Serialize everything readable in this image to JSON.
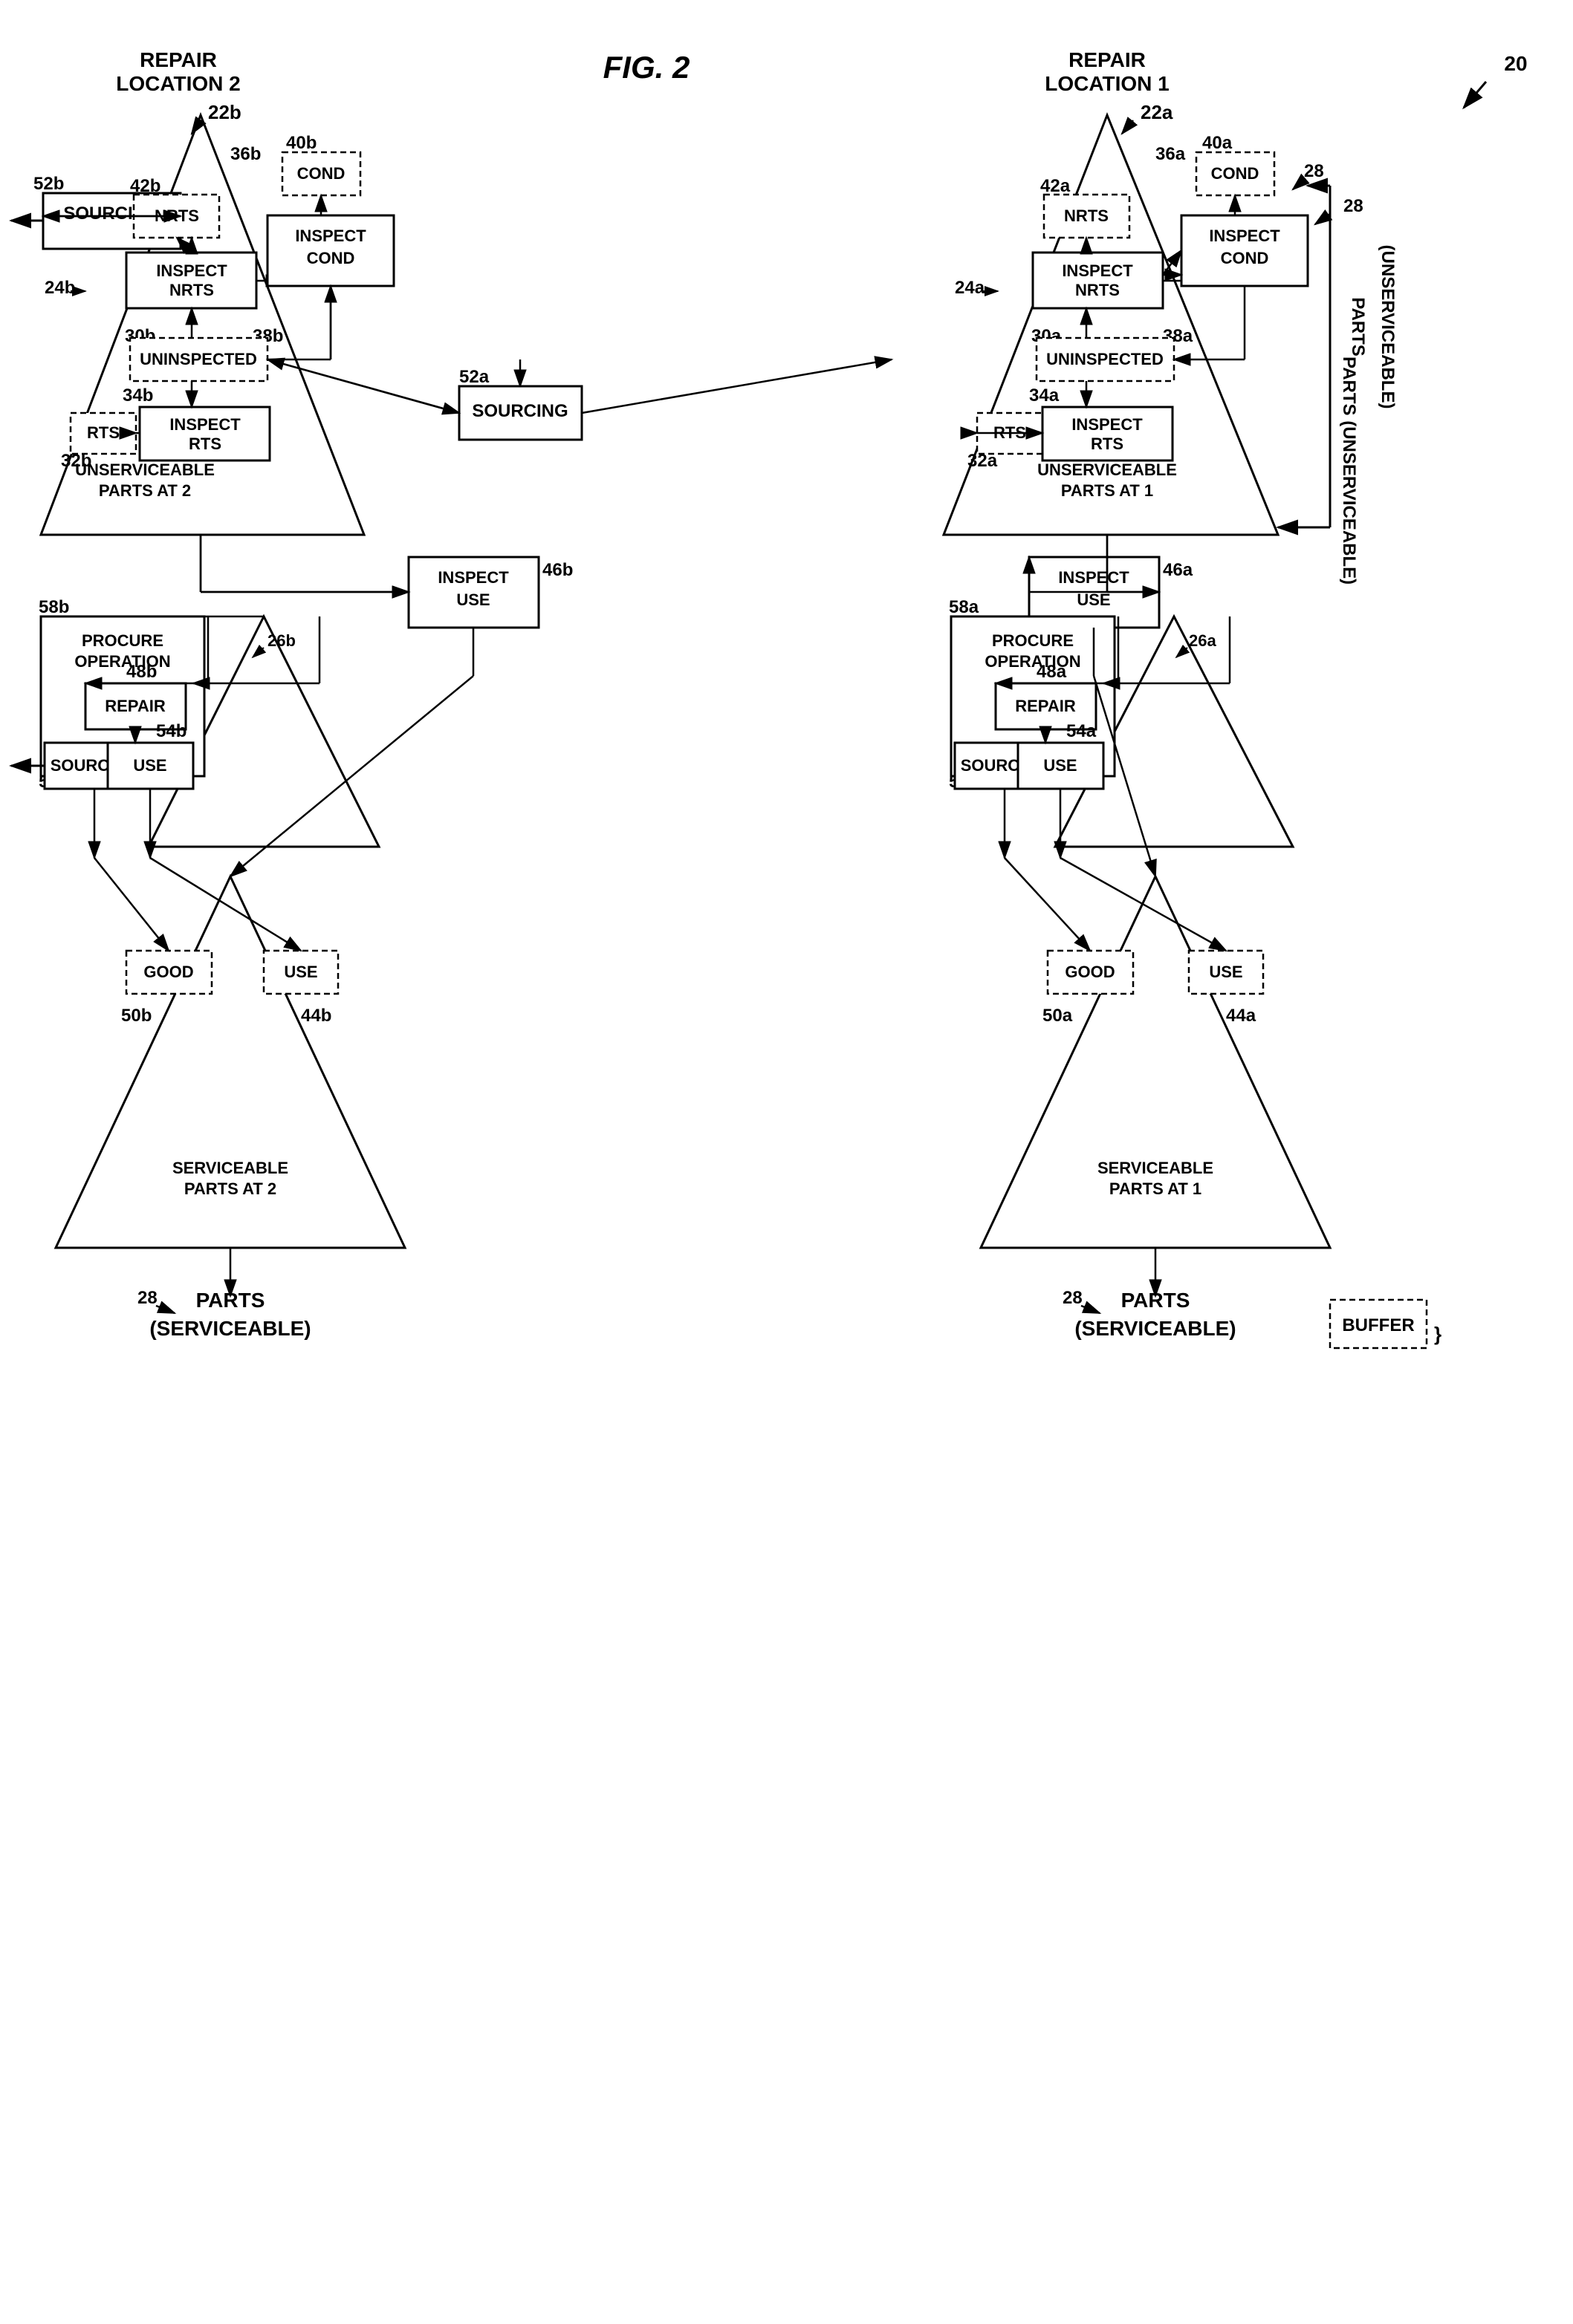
{
  "title": "FIG. 2",
  "figure_number": "20",
  "repair_location_1": "REPAIR\nLOCATION 1",
  "repair_location_2": "REPAIR\nLOCATION 2",
  "labels": {
    "fig2": "FIG. 2",
    "ref20": "20",
    "ref22a": "22a",
    "ref22b": "22b",
    "ref24a": "24a",
    "ref24b": "24b",
    "ref26a": "26a",
    "ref26b": "26b",
    "ref28_1": "28",
    "ref28_2": "28",
    "ref28_3": "28",
    "ref30a": "30a",
    "ref30b": "30b",
    "ref32a": "32a",
    "ref32b": "32b",
    "ref34a": "34a",
    "ref34b": "34b",
    "ref36a": "36a",
    "ref36b": "36b",
    "ref38a": "38a",
    "ref38b": "38b",
    "ref40a": "40a",
    "ref40b": "40b",
    "ref42a": "42a",
    "ref42b": "42b",
    "ref44a": "44a",
    "ref44b": "44b",
    "ref46a": "46a",
    "ref46b": "46b",
    "ref48a": "48a",
    "ref48b": "48b",
    "ref50a": "50a",
    "ref50b": "50b",
    "ref52a": "52a",
    "ref52b": "52b",
    "ref54a": "54a",
    "ref54b": "54b",
    "ref56a": "56a",
    "ref56b": "56b",
    "ref58a": "58a",
    "ref58b": "58b"
  }
}
